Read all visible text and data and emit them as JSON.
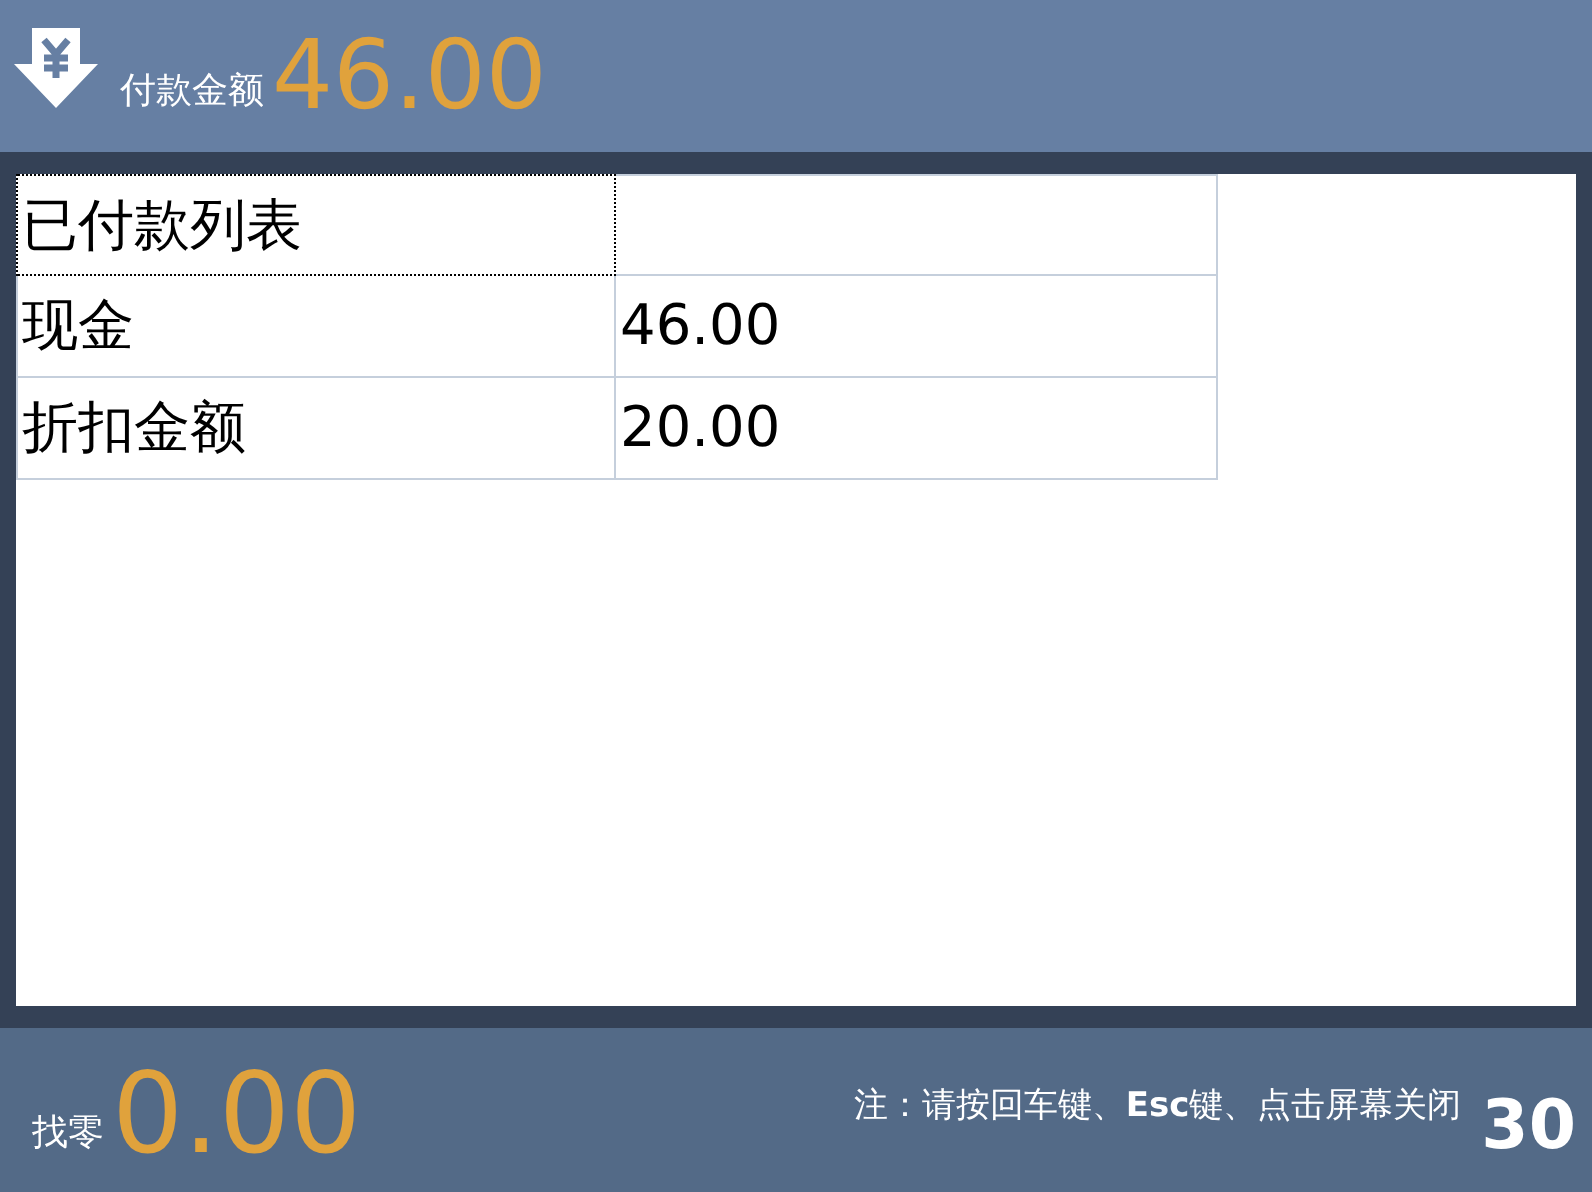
{
  "header": {
    "label": "付款金额",
    "amount": "46.00"
  },
  "table": {
    "title": {
      "text": "已付款列表",
      "focused": true
    },
    "rows": [
      {
        "name": "现金",
        "amount": "46.00"
      },
      {
        "name": "折扣金额",
        "amount": "20.00"
      }
    ]
  },
  "footer": {
    "label": "找零",
    "amount": "0.00",
    "note": "注：请按回车键、**Esc**键、点击屏幕关闭",
    "countdown": "30"
  }
}
